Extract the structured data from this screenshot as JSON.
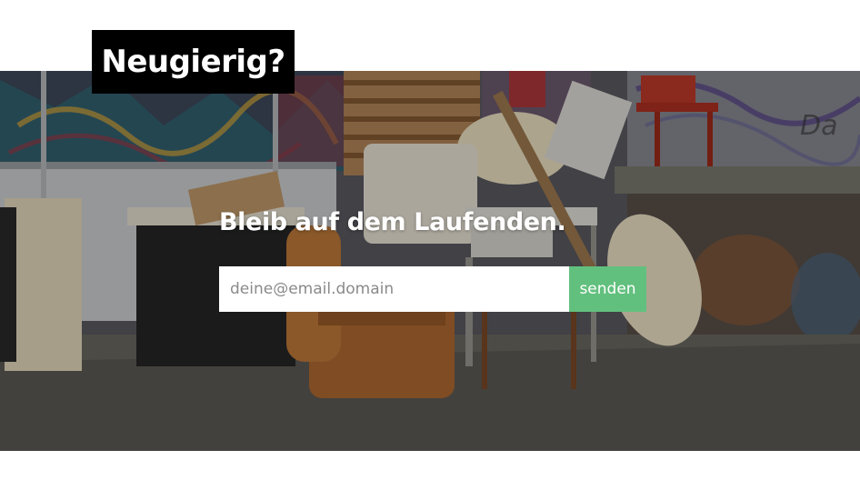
{
  "badge": {
    "title": "Neugierig?"
  },
  "newsletter": {
    "headline": "Bleib auf dem Laufenden.",
    "email_placeholder": "deine@email.domain",
    "email_value": "",
    "send_label": "senden"
  },
  "colors": {
    "badge_background": "#000000",
    "badge_text": "#ffffff",
    "send_button": "#62c07e",
    "input_background": "#ffffff"
  },
  "background_image": {
    "icon": "street-furniture-graffiti-photo"
  }
}
